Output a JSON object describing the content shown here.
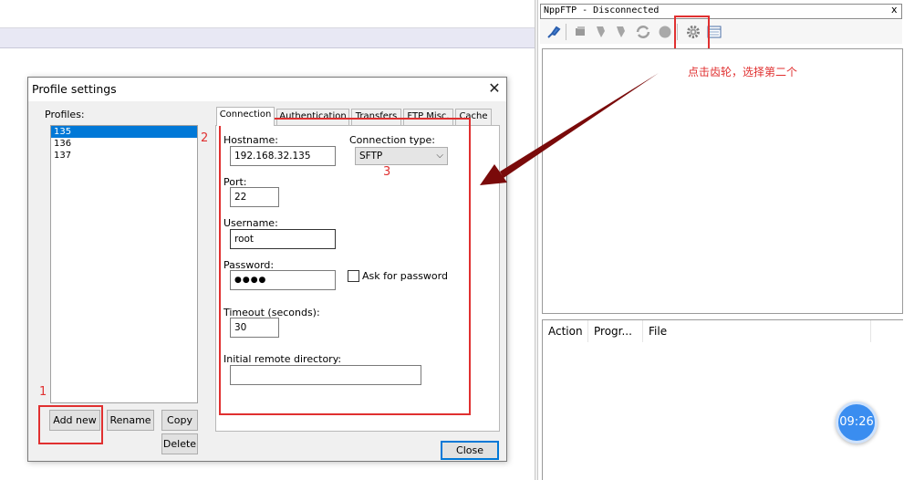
{
  "dialog": {
    "title": "Profile settings",
    "profiles_label": "Profiles:",
    "profiles": [
      "135",
      "136",
      "137"
    ],
    "selected_profile": "135",
    "buttons": {
      "add_new": "Add new",
      "rename": "Rename",
      "copy": "Copy",
      "delete": "Delete",
      "close": "Close"
    },
    "tabs": [
      "Connection",
      "Authentication",
      "Transfers",
      "FTP Misc.",
      "Cache"
    ],
    "active_tab": "Connection",
    "connection": {
      "hostname_label": "Hostname:",
      "hostname": "192.168.32.135",
      "connection_type_label": "Connection type:",
      "connection_type": "SFTP",
      "port_label": "Port:",
      "port": "22",
      "username_label": "Username:",
      "username": "root",
      "password_label": "Password:",
      "password_masked": "●●●●",
      "ask_for_password_label": "Ask for password",
      "ask_for_password_checked": false,
      "timeout_label": "Timeout (seconds):",
      "timeout": "30",
      "initial_dir_label": "Initial remote directory:",
      "initial_dir": ""
    }
  },
  "annotations": {
    "num1": "1",
    "num2": "2",
    "num3": "3",
    "note": "点击齿轮，选择第二个",
    "color": "#e03030",
    "arrow_color": "#7a0a0a"
  },
  "ftp_panel": {
    "title": "NppFTP - Disconnected",
    "close_glyph": "x",
    "toolbar_icons": [
      "connect-icon",
      "upload-icon",
      "download-icon",
      "refresh-icon",
      "abort-icon",
      "gear-icon",
      "message-window-icon"
    ],
    "queue_columns": [
      "Action",
      "Progr...",
      "File"
    ]
  },
  "clock": {
    "time": "09:26"
  },
  "colors": {
    "selection": "#0078d7",
    "accent_blue": "#3a8df0"
  }
}
